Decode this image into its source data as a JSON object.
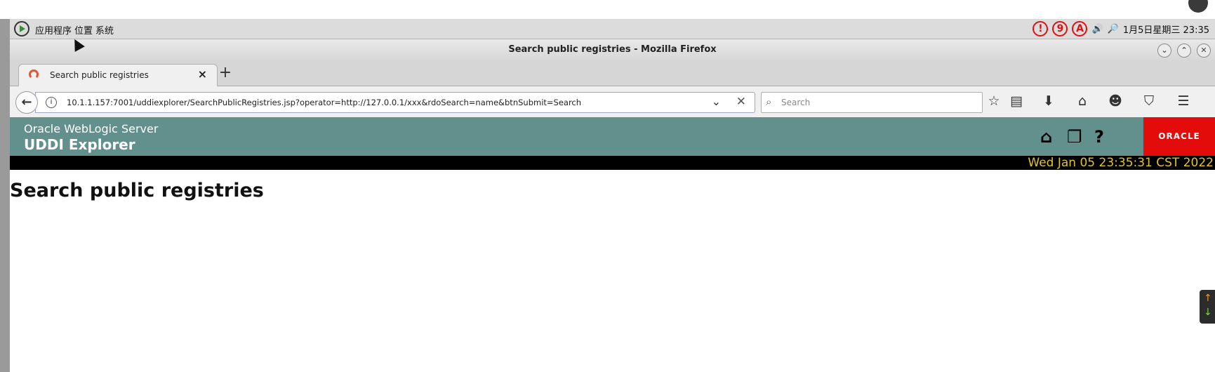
{
  "taskbar": {
    "menus": [
      "应用程序",
      "位置",
      "系统"
    ],
    "tray_badges": [
      "!",
      "9",
      "A"
    ],
    "clock": "1月5日星期三 23:35"
  },
  "browser": {
    "window_title": "Search public registries - Mozilla Firefox",
    "tab_title": "Search public registries",
    "url": "10.1.1.157:7001/uddiexplorer/SearchPublicRegistries.jsp?operator=http://127.0.0.1/xxx&rdoSearch=name&btnSubmit=Search",
    "search_placeholder": "Search",
    "new_tab_symbol": "+",
    "close_tab_symbol": "×"
  },
  "page": {
    "banner_sub": "Oracle WebLogic Server",
    "banner_title": "UDDI Explorer",
    "logo_text": "ORACLE",
    "datetime": "Wed Jan 05 23:35:31 CST 2022",
    "heading": "Search public registries"
  },
  "colors": {
    "banner": "#62908c",
    "oracle_red": "#e40b0b",
    "date_text": "#e2c22a"
  }
}
